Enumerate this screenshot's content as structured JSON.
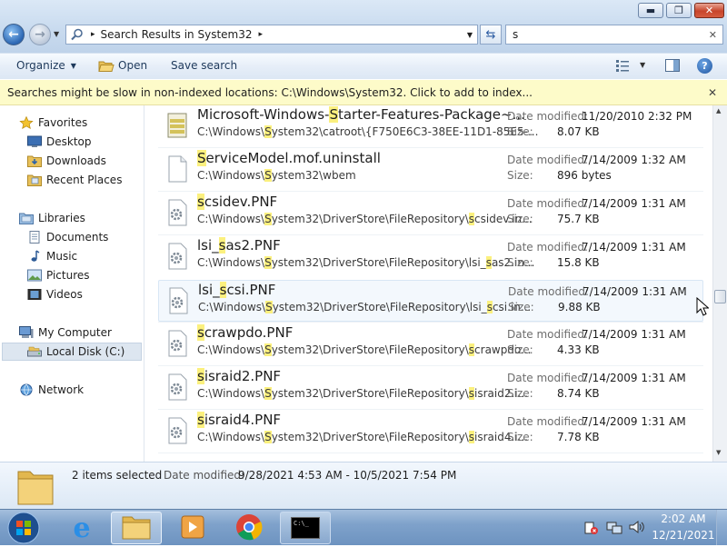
{
  "window": {
    "min_glyph": "▬",
    "max_glyph": "❐",
    "close_glyph": "✕"
  },
  "address": {
    "breadcrumb": "Search Results in System32",
    "chevron": "▸"
  },
  "search": {
    "value": "s",
    "clear_glyph": "✕"
  },
  "toolbar": {
    "organize": "Organize",
    "open": "Open",
    "save_search": "Save search"
  },
  "infobar": {
    "message": "Searches might be slow in non-indexed locations: C:\\Windows\\System32. Click to add to index...",
    "close_glyph": "✕"
  },
  "nav": {
    "favorites": "Favorites",
    "desktop": "Desktop",
    "downloads": "Downloads",
    "recent_places": "Recent Places",
    "libraries": "Libraries",
    "documents": "Documents",
    "music": "Music",
    "pictures": "Pictures",
    "videos": "Videos",
    "my_computer": "My Computer",
    "local_disk": "Local Disk (C:)",
    "network": "Network"
  },
  "labels": {
    "date_modified": "Date modified:",
    "size": "Size:"
  },
  "files": [
    {
      "name_pre": "Microsoft-Windows-",
      "name_hl": "S",
      "name_post": "tarter-Features-Package~...",
      "path_pre": "C:\\Windows\\",
      "path_hl": "S",
      "path_post": "ystem32\\catroot\\{F750E6C3-38EE-11D1-85E5-...",
      "date": "11/20/2010 2:32 PM",
      "size": "8.07 KB",
      "icon": "package-icon"
    },
    {
      "name_pre": "",
      "name_hl": "S",
      "name_post": "erviceModel.mof.uninstall",
      "path_pre": "C:\\Windows\\",
      "path_hl": "S",
      "path_post": "ystem32\\wbem",
      "date": "7/14/2009 1:32 AM",
      "size": "896 bytes",
      "icon": "blank-file-icon"
    },
    {
      "name_pre": "",
      "name_hl": "s",
      "name_post": "csidev.PNF",
      "path_pre": "C:\\Windows\\",
      "path_hl": "S",
      "path_post": "ystem32\\DriverStore\\FileRepository\\",
      "path_hl2": "s",
      "path_post2": "csidev.in...",
      "date": "7/14/2009 1:31 AM",
      "size": "75.7 KB",
      "icon": "settings-file-icon"
    },
    {
      "name_pre": "lsi_",
      "name_hl": "s",
      "name_post": "as2.PNF",
      "path_pre": "C:\\Windows\\",
      "path_hl": "S",
      "path_post": "ystem32\\DriverStore\\FileRepository\\lsi_",
      "path_hl2": "s",
      "path_post2": "as2.in...",
      "date": "7/14/2009 1:31 AM",
      "size": "15.8 KB",
      "icon": "settings-file-icon"
    },
    {
      "name_pre": "lsi_",
      "name_hl": "s",
      "name_post": "csi.PNF",
      "path_pre": "C:\\Windows\\",
      "path_hl": "S",
      "path_post": "ystem32\\DriverStore\\FileRepository\\lsi_",
      "path_hl2": "s",
      "path_post2": "csi.in...",
      "date": "7/14/2009 1:31 AM",
      "size": "9.88 KB",
      "icon": "settings-file-icon"
    },
    {
      "name_pre": "",
      "name_hl": "s",
      "name_post": "crawpdo.PNF",
      "path_pre": "C:\\Windows\\",
      "path_hl": "S",
      "path_post": "ystem32\\DriverStore\\FileRepository\\",
      "path_hl2": "s",
      "path_post2": "crawpdo...",
      "date": "7/14/2009 1:31 AM",
      "size": "4.33 KB",
      "icon": "settings-file-icon"
    },
    {
      "name_pre": "",
      "name_hl": "s",
      "name_post": "israid2.PNF",
      "path_pre": "C:\\Windows\\",
      "path_hl": "S",
      "path_post": "ystem32\\DriverStore\\FileRepository\\",
      "path_hl2": "s",
      "path_post2": "israid2.i...",
      "date": "7/14/2009 1:31 AM",
      "size": "8.74 KB",
      "icon": "settings-file-icon"
    },
    {
      "name_pre": "",
      "name_hl": "s",
      "name_post": "israid4.PNF",
      "path_pre": "C:\\Windows\\",
      "path_hl": "S",
      "path_post": "ystem32\\DriverStore\\FileRepository\\",
      "path_hl2": "s",
      "path_post2": "israid4.i...",
      "date": "7/14/2009 1:31 AM",
      "size": "7.78 KB",
      "icon": "settings-file-icon"
    }
  ],
  "details": {
    "selected": "2 items selected",
    "date_label": "Date modified:",
    "date_range": "9/28/2021 4:53 AM - 10/5/2021 7:54 PM"
  },
  "taskbar": {
    "time": "2:02 AM",
    "date": "12/21/2021",
    "cmd_text": "C:\\_"
  }
}
